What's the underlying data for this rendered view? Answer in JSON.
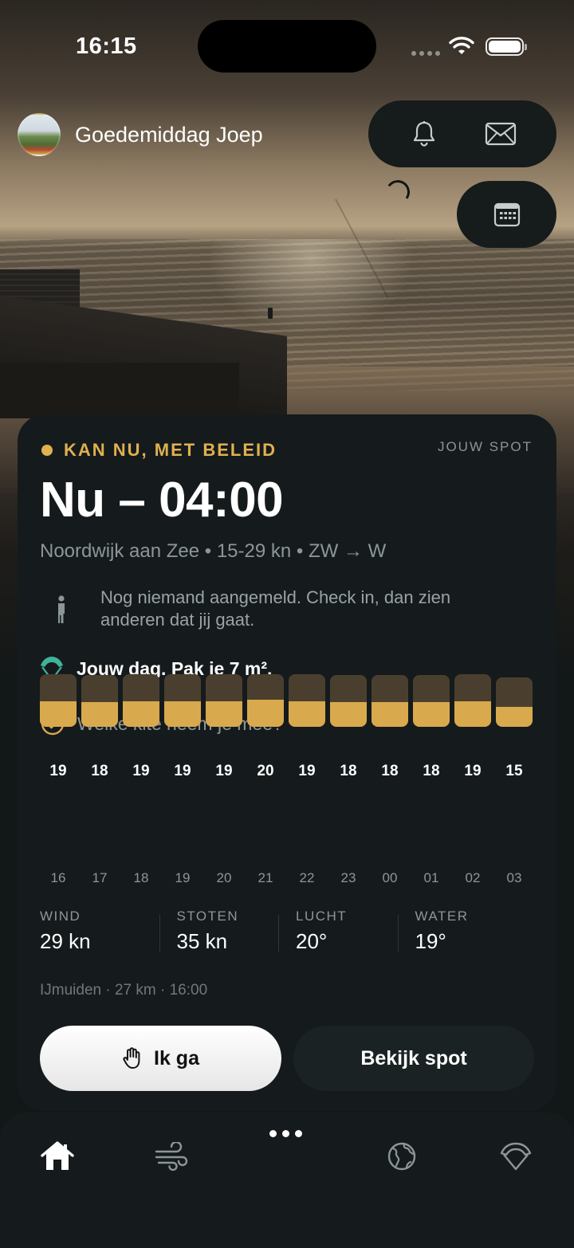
{
  "status_bar": {
    "time": "16:15"
  },
  "header": {
    "greeting": "Goedemiddag Joep"
  },
  "card": {
    "status_label": "KAN NU, MET BELEID",
    "status_color": "#e0b050",
    "spot_tag": "JOUW SPOT",
    "time_window": "Nu – 04:00",
    "meta": "Noordwijk aan Zee • 15-29 kn • ZW → W",
    "checkin_text": "Nog niemand aangemeld. Check in, dan zien anderen dat jij gaat.",
    "advice": "Jouw dag. Pak je 7 m².",
    "kite_question": "Welke kite neem je mee?",
    "stats": [
      {
        "label": "WIND",
        "value": "29 kn"
      },
      {
        "label": "STOTEN",
        "value": "35 kn"
      },
      {
        "label": "LUCHT",
        "value": "20°"
      },
      {
        "label": "WATER",
        "value": "19°"
      }
    ],
    "source": "IJmuiden · 27 km · 16:00",
    "go_button": "Ik ga",
    "spot_button": "Bekijk spot"
  },
  "chart_data": {
    "type": "bar",
    "categories": [
      "16",
      "17",
      "18",
      "19",
      "20",
      "21",
      "22",
      "23",
      "00",
      "01",
      "02",
      "03"
    ],
    "series": [
      {
        "values": [
          19,
          18,
          19,
          19,
          19,
          20,
          19,
          18,
          18,
          18,
          19,
          15
        ]
      }
    ],
    "fill_color": "#d9a94e",
    "track_color": "#4a3f2e"
  },
  "tabbar": {
    "items": [
      "home-icon",
      "wind-icon",
      "more-icon",
      "globe-icon",
      "kite-icon"
    ]
  }
}
